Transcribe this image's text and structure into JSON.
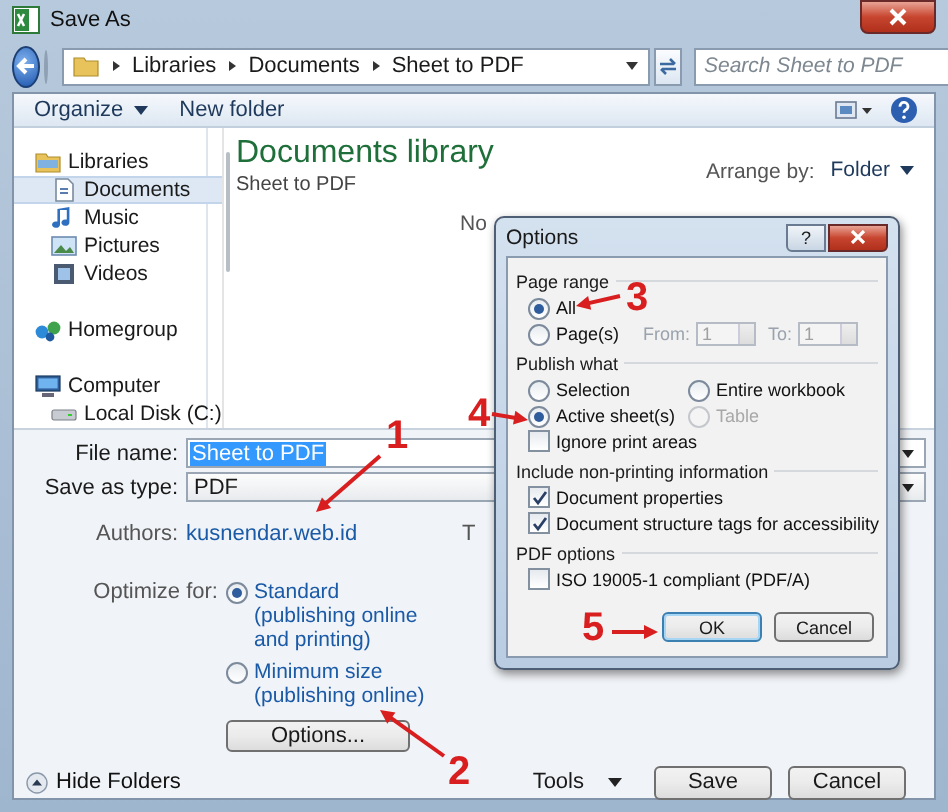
{
  "window": {
    "title": "Save As"
  },
  "address": {
    "path": [
      "Libraries",
      "Documents",
      "Sheet to PDF"
    ]
  },
  "search": {
    "placeholder": "Search Sheet to PDF"
  },
  "toolbar": {
    "organize": "Organize",
    "new_folder": "New folder"
  },
  "sidebar": {
    "items": [
      {
        "label": "Libraries",
        "kind": "library",
        "selected": false,
        "children": [
          {
            "label": "Documents",
            "kind": "documents",
            "selected": true
          },
          {
            "label": "Music",
            "kind": "music",
            "selected": false
          },
          {
            "label": "Pictures",
            "kind": "pictures",
            "selected": false
          },
          {
            "label": "Videos",
            "kind": "videos",
            "selected": false
          }
        ]
      },
      {
        "label": "Homegroup",
        "kind": "homegroup",
        "selected": false
      },
      {
        "label": "Computer",
        "kind": "computer",
        "selected": false,
        "children": [
          {
            "label": "Local Disk (C:)",
            "kind": "disk",
            "selected": false
          }
        ]
      }
    ]
  },
  "library": {
    "title": "Documents library",
    "subtitle": "Sheet to PDF",
    "arrange_label": "Arrange by:",
    "arrange_value": "Folder",
    "message": "No"
  },
  "form": {
    "file_name_label": "File name:",
    "file_name": "Sheet to PDF",
    "type_label": "Save as type:",
    "type": "PDF",
    "authors_label": "Authors:",
    "authors": "kusnendar.web.id",
    "column_2": "T",
    "optimize_label": "Optimize for:",
    "optimize_options": [
      {
        "label": "Standard (publishing online and printing)",
        "selected": true
      },
      {
        "label": "Minimum size (publishing online)",
        "selected": false
      }
    ],
    "options_button": "Options..."
  },
  "footer": {
    "hide_folders": "Hide Folders",
    "tools": "Tools",
    "save": "Save",
    "cancel": "Cancel"
  },
  "options_dialog": {
    "title": "Options",
    "help": "?",
    "page_range": {
      "heading": "Page range",
      "options": [
        {
          "label": "All",
          "selected": true
        },
        {
          "label": "Page(s)",
          "selected": false
        }
      ],
      "from_label": "From:",
      "from": "1",
      "to_label": "To:",
      "to": "1",
      "range_disabled": true
    },
    "publish_what": {
      "heading": "Publish what",
      "options": [
        {
          "label": "Selection",
          "selected": false,
          "disabled": false
        },
        {
          "label": "Entire workbook",
          "selected": false,
          "disabled": false
        },
        {
          "label": "Active sheet(s)",
          "selected": true,
          "disabled": false
        },
        {
          "label": "Table",
          "selected": false,
          "disabled": true
        }
      ],
      "ignore_print_areas": {
        "label": "Ignore print areas",
        "checked": false
      }
    },
    "non_printing": {
      "heading": "Include non-printing information",
      "items": [
        {
          "label": "Document properties",
          "checked": true
        },
        {
          "label": "Document structure tags for accessibility",
          "checked": true
        }
      ]
    },
    "pdf_options": {
      "heading": "PDF options",
      "items": [
        {
          "label": "ISO 19005-1 compliant (PDF/A)",
          "checked": false
        }
      ]
    },
    "ok": "OK",
    "cancel": "Cancel"
  },
  "annotations": [
    {
      "label": "1"
    },
    {
      "label": "2"
    },
    {
      "label": "3"
    },
    {
      "label": "4"
    },
    {
      "label": "5"
    }
  ]
}
